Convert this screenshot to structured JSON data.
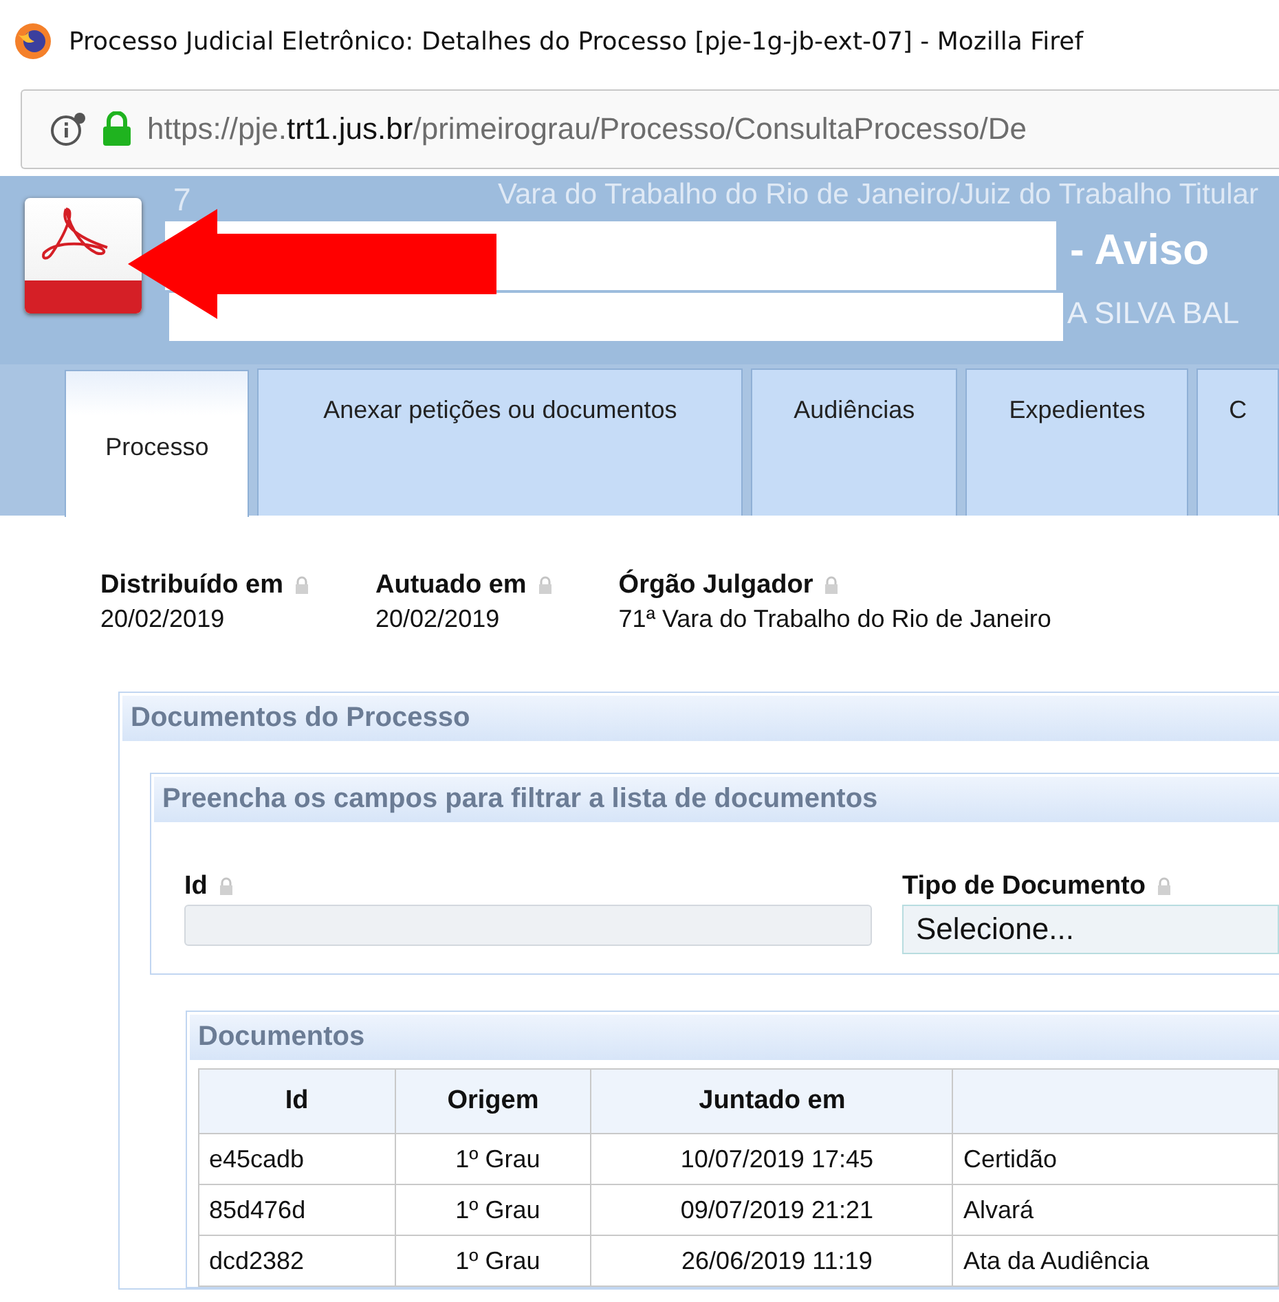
{
  "window": {
    "title": "Processo Judicial Eletrônico: Detalhes do Processo [pje-1g-jb-ext-07] - Mozilla Firef"
  },
  "address_bar": {
    "url_prefix": "https://pje.",
    "url_domain": "trt1.jus.br",
    "url_path": "/primeirograu/Processo/ConsultaProcesso/De"
  },
  "header": {
    "digit": "7",
    "court": "Vara do Trabalho do Rio de Janeiro/Juiz do Trabalho Titular",
    "title_suffix": "- Aviso",
    "party_suffix": "A SILVA BAL"
  },
  "tabs": [
    {
      "label": "Processo",
      "selected": true
    },
    {
      "label": "Anexar petições ou documentos",
      "selected": false
    },
    {
      "label": "Audiências",
      "selected": false
    },
    {
      "label": "Expedientes",
      "selected": false
    },
    {
      "label": "C",
      "selected": false
    }
  ],
  "details": [
    {
      "label": "Distribuído em",
      "value": "20/02/2019"
    },
    {
      "label": "Autuado em",
      "value": "20/02/2019"
    },
    {
      "label": "Órgão Julgador",
      "value": "71ª Vara do Trabalho do Rio de Janeiro"
    }
  ],
  "documents_panel": {
    "title": "Documentos do Processo",
    "filter": {
      "title": "Preencha os campos para filtrar a lista de documentos",
      "id_label": "Id",
      "type_label": "Tipo de Documento",
      "type_value": "Selecione..."
    },
    "table": {
      "title": "Documentos",
      "columns": [
        "Id",
        "Origem",
        "Juntado em"
      ],
      "rows": [
        [
          "e45cadb",
          "1º Grau",
          "10/07/2019 17:45",
          "Certidão"
        ],
        [
          "85d476d",
          "1º Grau",
          "09/07/2019 21:21",
          "Alvará"
        ],
        [
          "dcd2382",
          "1º Grau",
          "26/06/2019 11:19",
          "Ata da Audiência"
        ]
      ]
    }
  }
}
